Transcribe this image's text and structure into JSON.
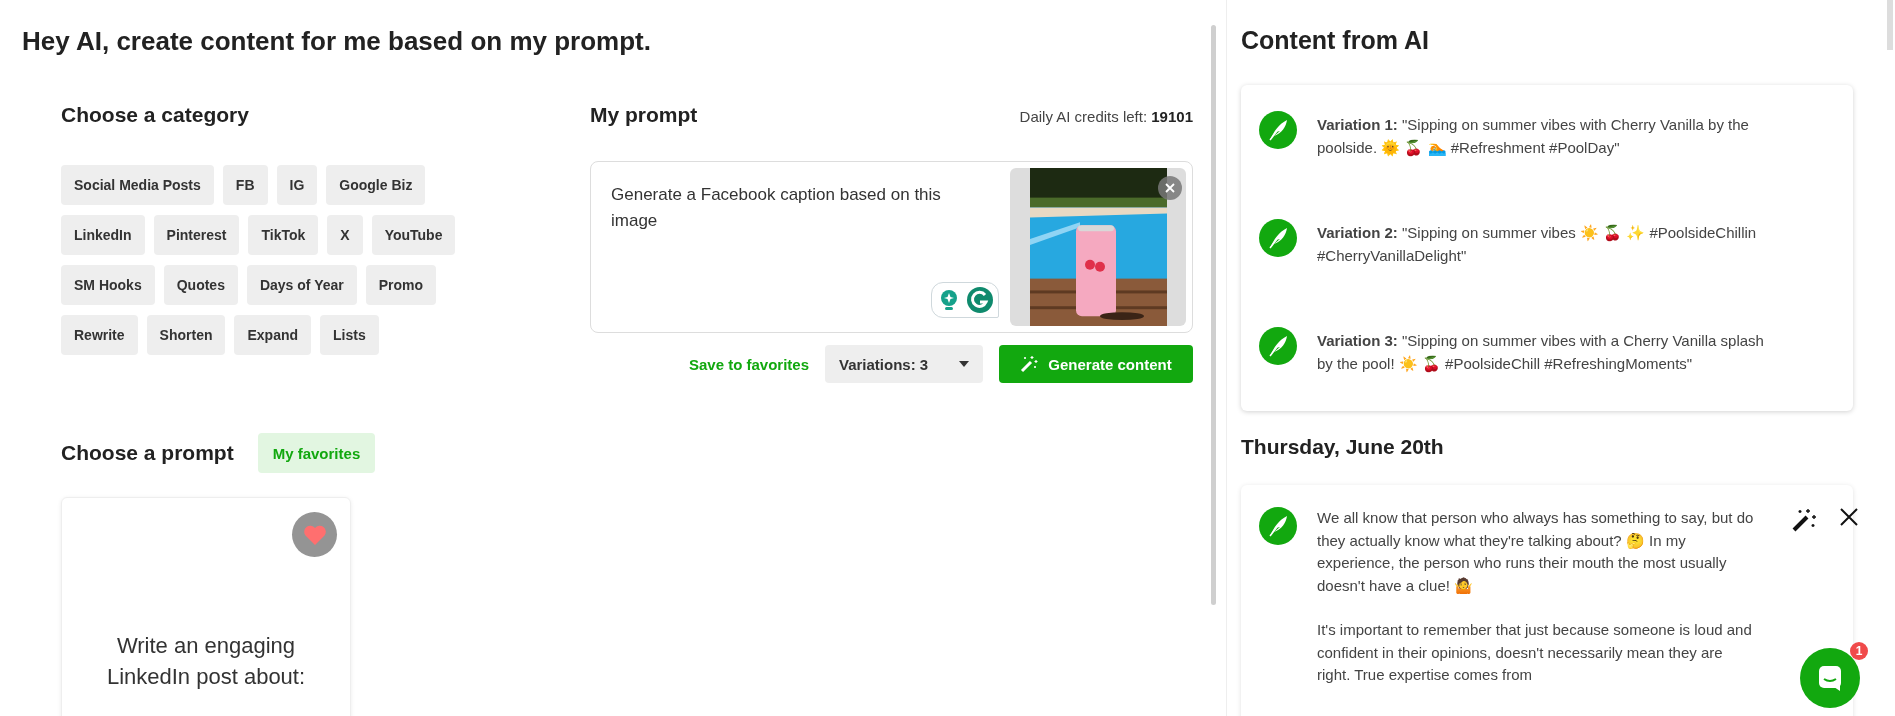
{
  "page_title": "Hey AI, create content for me based on my prompt.",
  "category_section": {
    "title": "Choose a category",
    "chip_rows": [
      [
        {
          "label": "Social Media Posts"
        },
        {
          "label": "FB"
        },
        {
          "label": "IG"
        },
        {
          "label": "Google Biz"
        }
      ],
      [
        {
          "label": "LinkedIn"
        },
        {
          "label": "Pinterest"
        },
        {
          "label": "TikTok"
        },
        {
          "label": "X"
        },
        {
          "label": "YouTube"
        }
      ],
      [
        {
          "label": "SM Hooks"
        },
        {
          "label": "Quotes"
        },
        {
          "label": "Days of Year"
        },
        {
          "label": "Promo"
        }
      ],
      [
        {
          "label": "Rewrite"
        },
        {
          "label": "Shorten"
        },
        {
          "label": "Expand"
        },
        {
          "label": "Lists"
        }
      ]
    ]
  },
  "prompt_section": {
    "title": "My prompt",
    "credits_label": "Daily AI credits left:",
    "credits_value": "19101",
    "prompt_text": "Generate a Facebook caption based on this image",
    "save_link": "Save to favorites",
    "variations": "Variations: 3",
    "generate_button": "Generate content"
  },
  "prompt_list": {
    "title": "Choose a prompt",
    "favorites_button": "My favorites",
    "cards": [
      {
        "text": "Write an engaging LinkedIn post about:",
        "favorite": true
      }
    ]
  },
  "content_panel": {
    "title": "Content from AI",
    "variations": [
      {
        "text": "**Variation 1:**  \"Sipping on summer vibes with Cherry Vanilla by the poolside. 🌞 🍒 🏊 #Refreshment #PoolDay\""
      },
      {
        "text": "**Variation 2:**  \"Sipping on summer vibes ☀️ 🍒 ✨ #PoolsideChillin #CherryVanillaDelight\""
      },
      {
        "text": "**Variation 3:**  \"Sipping on summer vibes with a Cherry Vanilla splash by the pool! ☀️ 🍒 #PoolsideChill #RefreshingMoments\""
      }
    ],
    "date": "Thursday, June 20th",
    "post": {
      "paragraphs": [
        "We all know that person who always has something to say, but do they actually know what they're talking about? 🤔 In my experience, the person who runs their mouth the most usually doesn't have a clue! 🤷",
        "It's important to remember that just because someone is loud and confident in their opinions, doesn't necessarily mean they are right. True expertise comes from"
      ]
    }
  },
  "chat": {
    "badge": "1"
  }
}
